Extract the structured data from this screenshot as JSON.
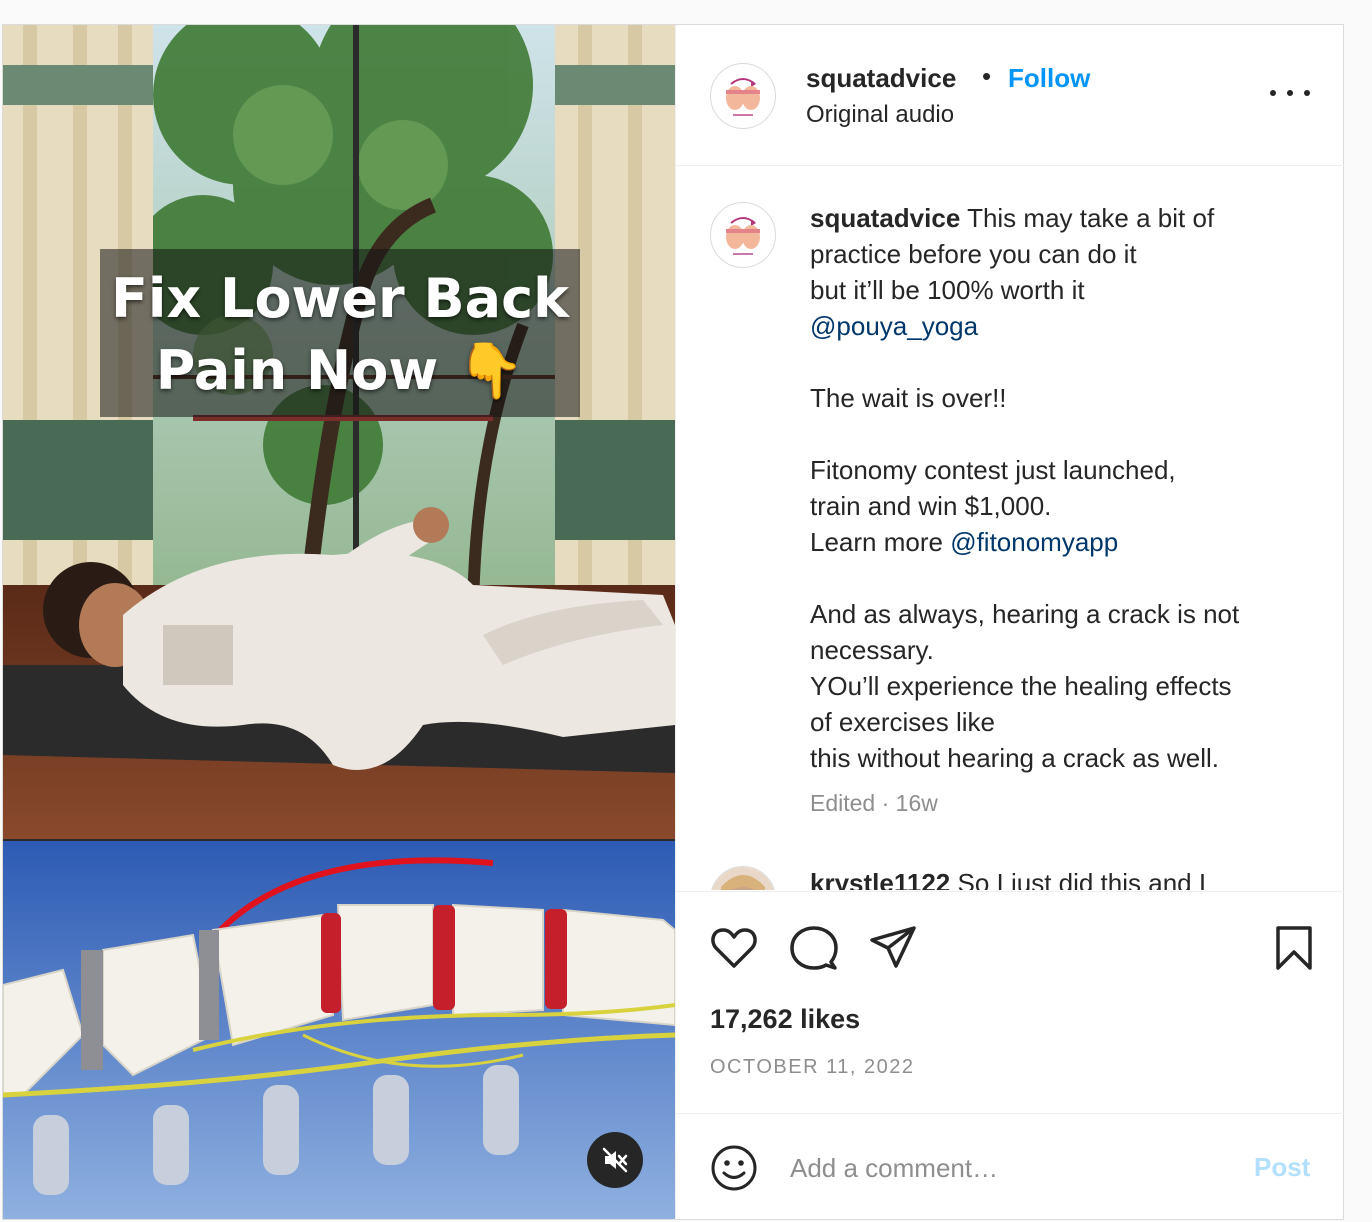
{
  "colors": {
    "accent": "#0095f6",
    "mention": "#00376b",
    "muted_text": "#8e8e8e",
    "post_disabled": "#b2dffc",
    "border": "#dbdbdb"
  },
  "video": {
    "overlay_lines": [
      "Fix Lower Back",
      "Pain Now"
    ],
    "overlay_emoji": "👇",
    "muted": true,
    "mute_icon": "speaker-muted-icon"
  },
  "header": {
    "username": "squatadvice",
    "separator": "•",
    "follow_label": "Follow",
    "audio": "Original audio",
    "more_icon": "more-options-icon"
  },
  "caption": {
    "username": "squatadvice",
    "first_line": "This may take a bit of",
    "lines": [
      "practice before you can do it",
      "but it’ll be 100% worth it",
      "",
      "",
      "The wait is over!!",
      "",
      "Fitonomy contest just launched,",
      "train and win $1,000.",
      "",
      "",
      "And as always, hearing a crack is not",
      "necessary.",
      "YOu’ll experience the healing effects",
      "of exercises like",
      "this without hearing a crack as well."
    ],
    "mention_1": "@pouya_yoga",
    "learn_more": "Learn more ",
    "mention_2": "@fitonomyapp",
    "edited": "Edited",
    "meta_separator": " · ",
    "age": "16w"
  },
  "next_comment": {
    "username": "krystle1122",
    "text": "So I just did this and I"
  },
  "actions": {
    "like_icon": "heart-icon",
    "comment_icon": "comment-icon",
    "share_icon": "share-icon",
    "save_icon": "bookmark-icon",
    "likes": "17,262 likes",
    "date": "OCTOBER 11, 2022"
  },
  "comment_box": {
    "emoji_icon": "emoji-icon",
    "placeholder": "Add a comment…",
    "post_label": "Post"
  }
}
